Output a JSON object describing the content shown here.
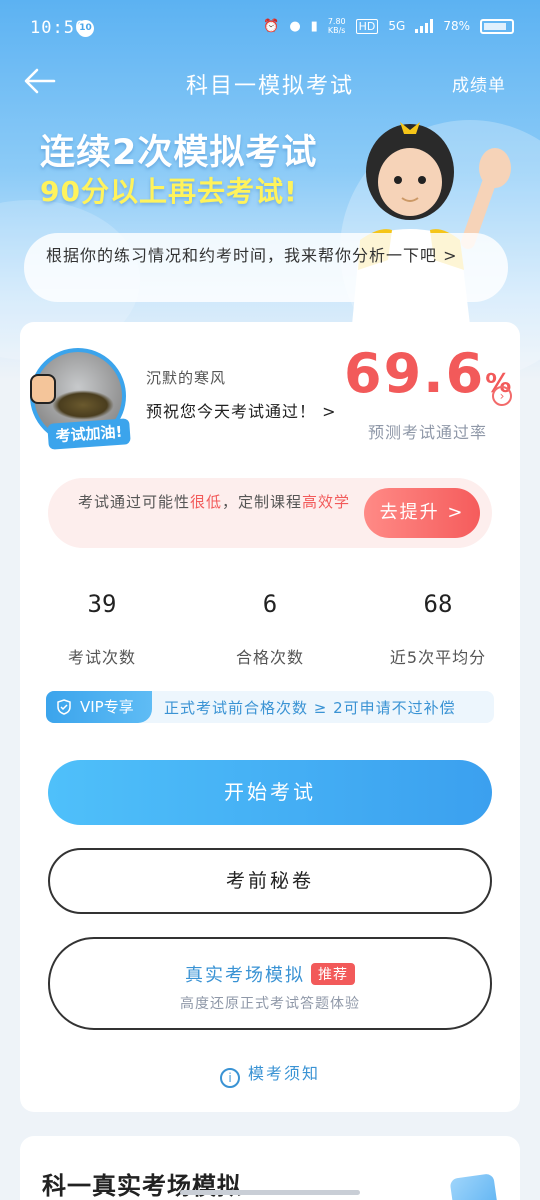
{
  "status": {
    "time": "10:50",
    "notif": "10",
    "speed": "7.80\nKB/s",
    "hd": "HD",
    "net": "5G",
    "battery": "78%"
  },
  "nav": {
    "title": "科目一模拟考试",
    "right_label": "成绩单"
  },
  "hero": {
    "headline1": "连续2次模拟考试",
    "headline2": "90分以上再去考试!",
    "bubble": "根据你的练习情况和约考时间，我来帮你分析一下吧 >"
  },
  "profile": {
    "avatar_badge": "考试加油!",
    "username": "沉默的寒风",
    "wish": "预祝您今天考试通过！ >"
  },
  "prediction": {
    "value": "69.6",
    "unit": "%",
    "label": "预测考试通过率"
  },
  "alert": {
    "text_prefix": "考试通过可能性",
    "text_low": "很低",
    "text_mid": "，定制课程",
    "text_high": "高效学",
    "button": "去提升 >"
  },
  "stats": [
    {
      "num": "39",
      "label": "考试次数"
    },
    {
      "num": "6",
      "label": "合格次数"
    },
    {
      "num": "68",
      "label": "近5次平均分"
    }
  ],
  "vip": {
    "badge": "VIP专享",
    "text": "正式考试前合格次数 ≥ 2可申请不过补偿"
  },
  "buttons": {
    "start": "开始考试",
    "secret": "考前秘卷",
    "real_title": "真实考场模拟",
    "real_tag": "推荐",
    "real_sub": "高度还原正式考试答题体验"
  },
  "notice": {
    "label": "模考须知"
  },
  "section2": {
    "title": "科一真实考场模拟"
  },
  "colors": {
    "primary": "#3ba4ec",
    "danger": "#f25a5a",
    "gold": "#fff35c"
  }
}
